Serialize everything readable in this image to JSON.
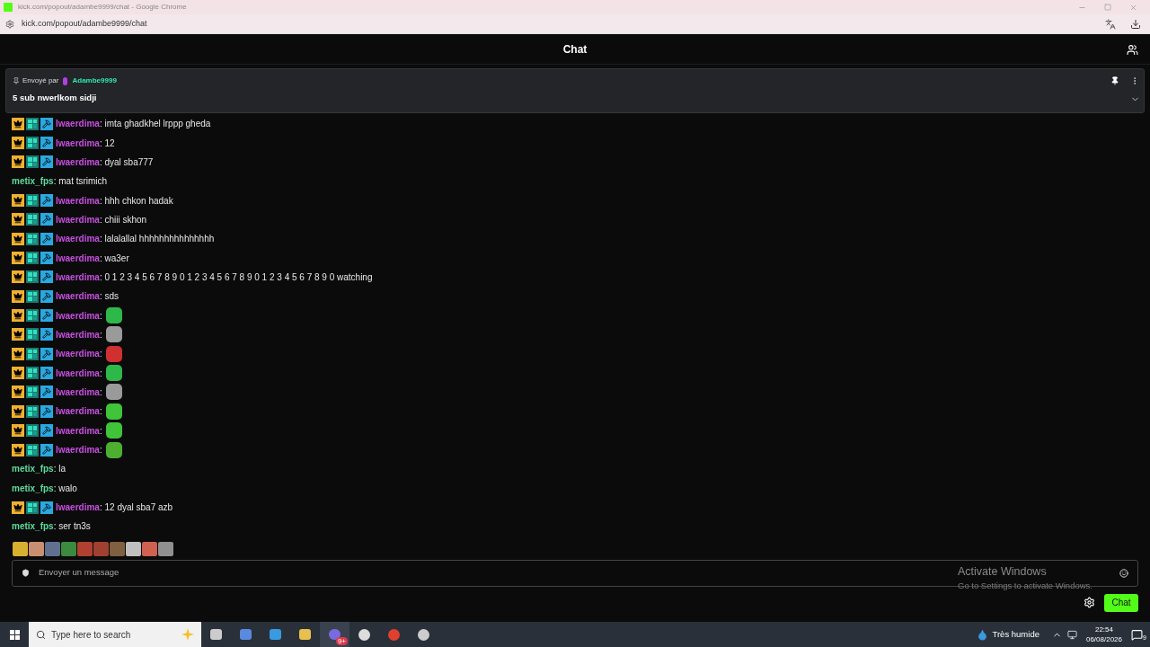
{
  "browser": {
    "title": "kick.com/popout/adambe9999/chat - Google Chrome",
    "url": "kick.com/popout/adambe9999/chat"
  },
  "header": {
    "title": "Chat"
  },
  "pinned": {
    "label": "Envoyé par",
    "author": "Adambe9999",
    "message": "5 sub nwerlkom sidji"
  },
  "messages": [
    {
      "kind": "text",
      "user": "lwaerdima",
      "color": "#c84fe0",
      "badges": true,
      "text": ": imta ghadkhel lrppp gheda"
    },
    {
      "kind": "text",
      "user": "lwaerdima",
      "color": "#c84fe0",
      "badges": true,
      "text": ": 12"
    },
    {
      "kind": "text",
      "user": "lwaerdima",
      "color": "#c84fe0",
      "badges": true,
      "text": ": dyal sba777"
    },
    {
      "kind": "text",
      "user": "metix_fps",
      "color": "#5edc9c",
      "badges": false,
      "text": ": mat tsrimich"
    },
    {
      "kind": "text",
      "user": "lwaerdima",
      "color": "#c84fe0",
      "badges": true,
      "text": ": hhh chkon hadak"
    },
    {
      "kind": "text",
      "user": "lwaerdima",
      "color": "#c84fe0",
      "badges": true,
      "text": ": chiii skhon"
    },
    {
      "kind": "text",
      "user": "lwaerdima",
      "color": "#c84fe0",
      "badges": true,
      "text": ": lalalallal hhhhhhhhhhhhhhh"
    },
    {
      "kind": "text",
      "user": "lwaerdima",
      "color": "#c84fe0",
      "badges": true,
      "text": ": wa3er"
    },
    {
      "kind": "text",
      "user": "lwaerdima",
      "color": "#c84fe0",
      "badges": true,
      "text": ": 0 1 2 3 4 5 6 7 8 9 0 1 2 3 4 5 6 7 8 9 0 1 2 3 4 5 6 7 8 9 0 watching"
    },
    {
      "kind": "text",
      "user": "lwaerdima",
      "color": "#c84fe0",
      "badges": true,
      "text": ": sds"
    },
    {
      "kind": "emote",
      "user": "lwaerdima",
      "color": "#c84fe0",
      "badges": true,
      "text": ":"
    },
    {
      "kind": "emote",
      "user": "lwaerdima",
      "color": "#c84fe0",
      "badges": true,
      "text": ":"
    },
    {
      "kind": "emote",
      "user": "lwaerdima",
      "color": "#c84fe0",
      "badges": true,
      "text": ":"
    },
    {
      "kind": "emote",
      "user": "lwaerdima",
      "color": "#c84fe0",
      "badges": true,
      "text": ":"
    },
    {
      "kind": "emote",
      "user": "lwaerdima",
      "color": "#c84fe0",
      "badges": true,
      "text": ":"
    },
    {
      "kind": "emote",
      "user": "lwaerdima",
      "color": "#c84fe0",
      "badges": true,
      "text": ":"
    },
    {
      "kind": "emote",
      "user": "lwaerdima",
      "color": "#c84fe0",
      "badges": true,
      "text": ":"
    },
    {
      "kind": "emote",
      "user": "lwaerdima",
      "color": "#c84fe0",
      "badges": true,
      "text": ":"
    },
    {
      "kind": "text",
      "user": "metix_fps",
      "color": "#5edc9c",
      "badges": false,
      "text": ": la"
    },
    {
      "kind": "text",
      "user": "metix_fps",
      "color": "#5edc9c",
      "badges": false,
      "text": ": walo"
    },
    {
      "kind": "text",
      "user": "lwaerdima",
      "color": "#c84fe0",
      "badges": true,
      "text": ": 12 dyal sba7 azb"
    },
    {
      "kind": "text",
      "user": "metix_fps",
      "color": "#5edc9c",
      "badges": false,
      "text": ": ser tn3s"
    }
  ],
  "composer": {
    "placeholder": "Envoyer un message",
    "send": "Chat"
  },
  "activation": {
    "title": "Activate Windows",
    "subtitle": "Go to Settings to activate Windows."
  },
  "taskbar": {
    "search_placeholder": "Type here to search",
    "app_badge": "9+",
    "weather": "Très humide",
    "time": "22:54",
    "date": "06/08/2026",
    "notifications": "9"
  }
}
